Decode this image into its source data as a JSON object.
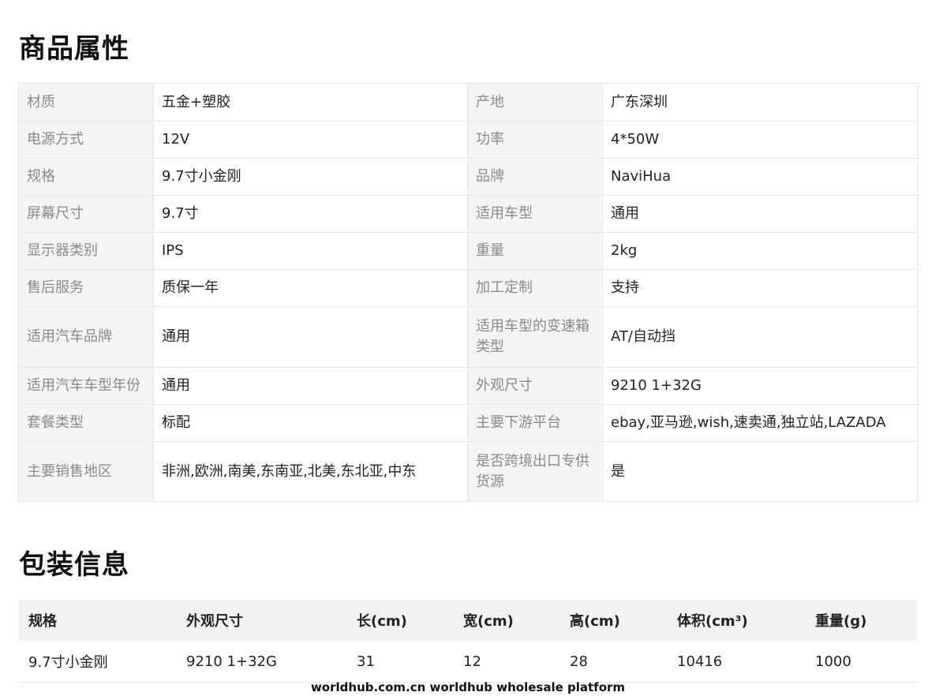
{
  "attributes_section": {
    "title": "商品属性",
    "rows": [
      [
        {
          "k": "材质",
          "v": "五金+塑胶"
        },
        {
          "k": "产地",
          "v": "广东深圳"
        }
      ],
      [
        {
          "k": "电源方式",
          "v": "12V"
        },
        {
          "k": "功率",
          "v": "4*50W"
        }
      ],
      [
        {
          "k": "规格",
          "v": "9.7寸小金刚"
        },
        {
          "k": "品牌",
          "v": "NaviHua"
        }
      ],
      [
        {
          "k": "屏幕尺寸",
          "v": "9.7寸"
        },
        {
          "k": "适用车型",
          "v": "通用"
        }
      ],
      [
        {
          "k": "显示器类别",
          "v": "IPS"
        },
        {
          "k": "重量",
          "v": "2kg"
        }
      ],
      [
        {
          "k": "售后服务",
          "v": "质保一年"
        },
        {
          "k": "加工定制",
          "v": "支持"
        }
      ],
      [
        {
          "k": "适用汽车品牌",
          "v": "通用"
        },
        {
          "k": "适用车型的变速箱类型",
          "v": "AT/自动挡"
        }
      ],
      [
        {
          "k": "适用汽车车型年份",
          "v": "通用"
        },
        {
          "k": "外观尺寸",
          "v": "9210 1+32G"
        }
      ],
      [
        {
          "k": "套餐类型",
          "v": "标配"
        },
        {
          "k": "主要下游平台",
          "v": "ebay,亚马逊,wish,速卖通,独立站,LAZADA"
        }
      ],
      [
        {
          "k": "主要销售地区",
          "v": "非洲,欧洲,南美,东南亚,北美,东北亚,中东"
        },
        {
          "k": "是否跨境出口专供货源",
          "v": "是"
        }
      ]
    ]
  },
  "packaging_section": {
    "title": "包装信息",
    "headers": [
      "规格",
      "外观尺寸",
      "长(cm)",
      "宽(cm)",
      "高(cm)",
      "体积(cm³)",
      "重量(g)"
    ],
    "rows": [
      [
        "9.7寸小金刚",
        "9210 1+32G",
        "31",
        "12",
        "28",
        "10416",
        "1000"
      ]
    ]
  },
  "footer": {
    "text": "worldhub.com.cn worldhub wholesale platform"
  }
}
